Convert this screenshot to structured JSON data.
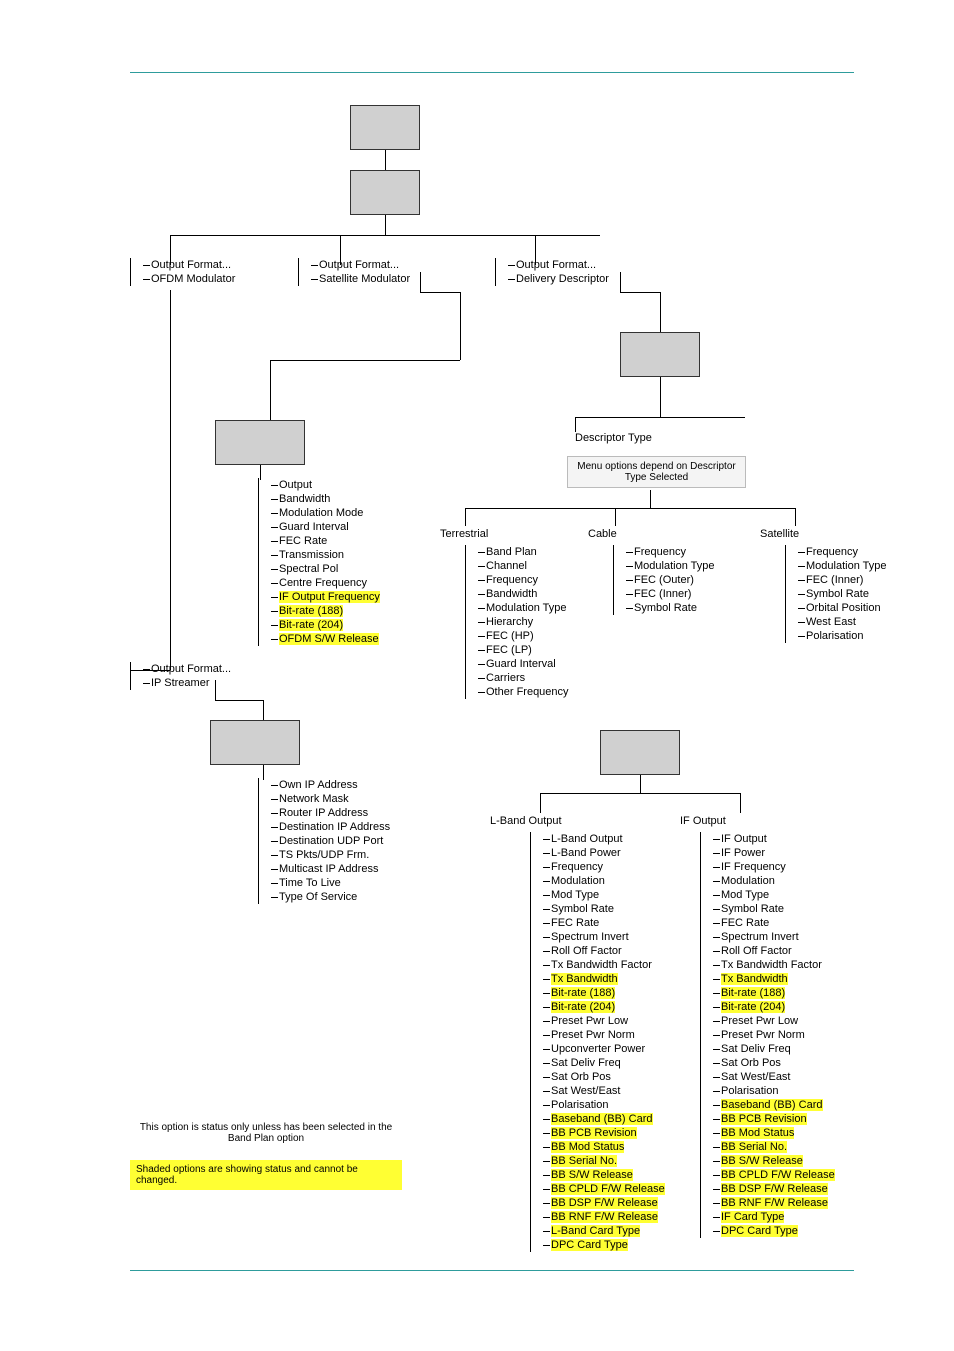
{
  "top_nodes": {
    "ofdm": {
      "a": "Output Format...",
      "b": "OFDM Modulator"
    },
    "sat": {
      "a": "Output Format...",
      "b": "Satellite Modulator"
    },
    "deliv": {
      "a": "Output Format...",
      "b": "Delivery Descriptor"
    },
    "ip": {
      "a": "Output Format...",
      "b": "IP Streamer"
    }
  },
  "descriptor_type_label": "Descriptor Type",
  "menu_note": "Menu options depend on Descriptor Type Selected",
  "sat_mod": {
    "items": [
      {
        "t": "Output"
      },
      {
        "t": "Bandwidth"
      },
      {
        "t": "Modulation Mode"
      },
      {
        "t": "Guard Interval"
      },
      {
        "t": "FEC Rate"
      },
      {
        "t": "Transmission"
      },
      {
        "t": "Spectral Pol"
      },
      {
        "t": "Centre Frequency"
      },
      {
        "t": "IF Output Frequency",
        "hl": true
      },
      {
        "t": "Bit-rate (188)",
        "hl": true
      },
      {
        "t": "Bit-rate (204)",
        "hl": true
      },
      {
        "t": "OFDM S/W Release",
        "hl": true
      }
    ]
  },
  "desc_sub": {
    "terrestrial": {
      "title": "Terrestrial",
      "items": [
        "Band Plan",
        "Channel",
        "Frequency",
        "Bandwidth",
        "Modulation Type",
        "Hierarchy",
        "FEC (HP)",
        "FEC (LP)",
        "Guard Interval",
        "Carriers",
        "Other Frequency"
      ]
    },
    "cable": {
      "title": "Cable",
      "items": [
        "Frequency",
        "Modulation Type",
        "FEC (Outer)",
        "FEC (Inner)",
        "Symbol Rate"
      ]
    },
    "satellite": {
      "title": "Satellite",
      "items": [
        "Frequency",
        "Modulation Type",
        "FEC (Inner)",
        "Symbol Rate",
        "Orbital Position",
        "West East",
        "Polarisation"
      ]
    }
  },
  "ip_streamer": {
    "items": [
      "Own IP Address",
      "Network Mask",
      "Router IP Address",
      "Destination IP Address",
      "Destination UDP Port",
      "TS Pkts/UDP Frm.",
      "Multicast IP Address",
      "Time To Live",
      "Type Of Service"
    ]
  },
  "output_groups": {
    "lband": {
      "title": "L-Band Output",
      "items": [
        {
          "t": "L-Band Output"
        },
        {
          "t": "L-Band Power"
        },
        {
          "t": "Frequency"
        },
        {
          "t": "Modulation"
        },
        {
          "t": "Mod Type"
        },
        {
          "t": "Symbol Rate"
        },
        {
          "t": "FEC Rate"
        },
        {
          "t": "Spectrum Invert"
        },
        {
          "t": "Roll Off Factor"
        },
        {
          "t": "Tx Bandwidth Factor"
        },
        {
          "t": "Tx Bandwidth",
          "hl": true
        },
        {
          "t": "Bit-rate (188)",
          "hl": true
        },
        {
          "t": "Bit-rate (204)",
          "hl": true
        },
        {
          "t": "Preset Pwr Low"
        },
        {
          "t": "Preset Pwr Norm"
        },
        {
          "t": "Upconverter Power"
        },
        {
          "t": "Sat Deliv Freq"
        },
        {
          "t": "Sat Orb Pos"
        },
        {
          "t": "Sat West/East"
        },
        {
          "t": "Polarisation"
        },
        {
          "t": "Baseband (BB) Card",
          "hl": true
        },
        {
          "t": "BB PCB Revision",
          "hl": true
        },
        {
          "t": "BB Mod Status",
          "hl": true
        },
        {
          "t": "BB Serial No.",
          "hl": true
        },
        {
          "t": "BB S/W Release",
          "hl": true
        },
        {
          "t": "BB CPLD F/W Release",
          "hl": true
        },
        {
          "t": "BB DSP F/W Release",
          "hl": true
        },
        {
          "t": "BB RNF F/W Release",
          "hl": true
        },
        {
          "t": "L-Band Card Type",
          "hl": true
        },
        {
          "t": "DPC Card Type",
          "hl": true
        }
      ]
    },
    "if": {
      "title": "IF Output",
      "items": [
        {
          "t": "IF Output"
        },
        {
          "t": "IF Power"
        },
        {
          "t": "IF Frequency"
        },
        {
          "t": "Modulation"
        },
        {
          "t": "Mod Type"
        },
        {
          "t": "Symbol Rate"
        },
        {
          "t": "FEC Rate"
        },
        {
          "t": "Spectrum Invert"
        },
        {
          "t": "Roll Off Factor"
        },
        {
          "t": "Tx Bandwidth Factor"
        },
        {
          "t": "Tx Bandwidth",
          "hl": true
        },
        {
          "t": "Bit-rate (188)",
          "hl": true
        },
        {
          "t": "Bit-rate (204)",
          "hl": true
        },
        {
          "t": "Preset Pwr Low"
        },
        {
          "t": "Preset Pwr Norm"
        },
        {
          "t": "Sat Deliv Freq"
        },
        {
          "t": "Sat Orb Pos"
        },
        {
          "t": "Sat West/East"
        },
        {
          "t": "Polarisation"
        },
        {
          "t": "Baseband (BB) Card",
          "hl": true
        },
        {
          "t": "BB PCB Revision",
          "hl": true
        },
        {
          "t": "BB Mod Status",
          "hl": true
        },
        {
          "t": "BB Serial No.",
          "hl": true
        },
        {
          "t": "BB S/W Release",
          "hl": true
        },
        {
          "t": "BB CPLD F/W Release",
          "hl": true
        },
        {
          "t": "BB DSP F/W Release",
          "hl": true
        },
        {
          "t": "BB RNF F/W Release",
          "hl": true
        },
        {
          "t": "IF Card Type",
          "hl": true
        },
        {
          "t": "DPC Card Type",
          "hl": true
        }
      ]
    }
  },
  "legend1": "This option is status only unless has been selected in the Band Plan option",
  "legend2": "Shaded options are showing status and cannot be changed."
}
